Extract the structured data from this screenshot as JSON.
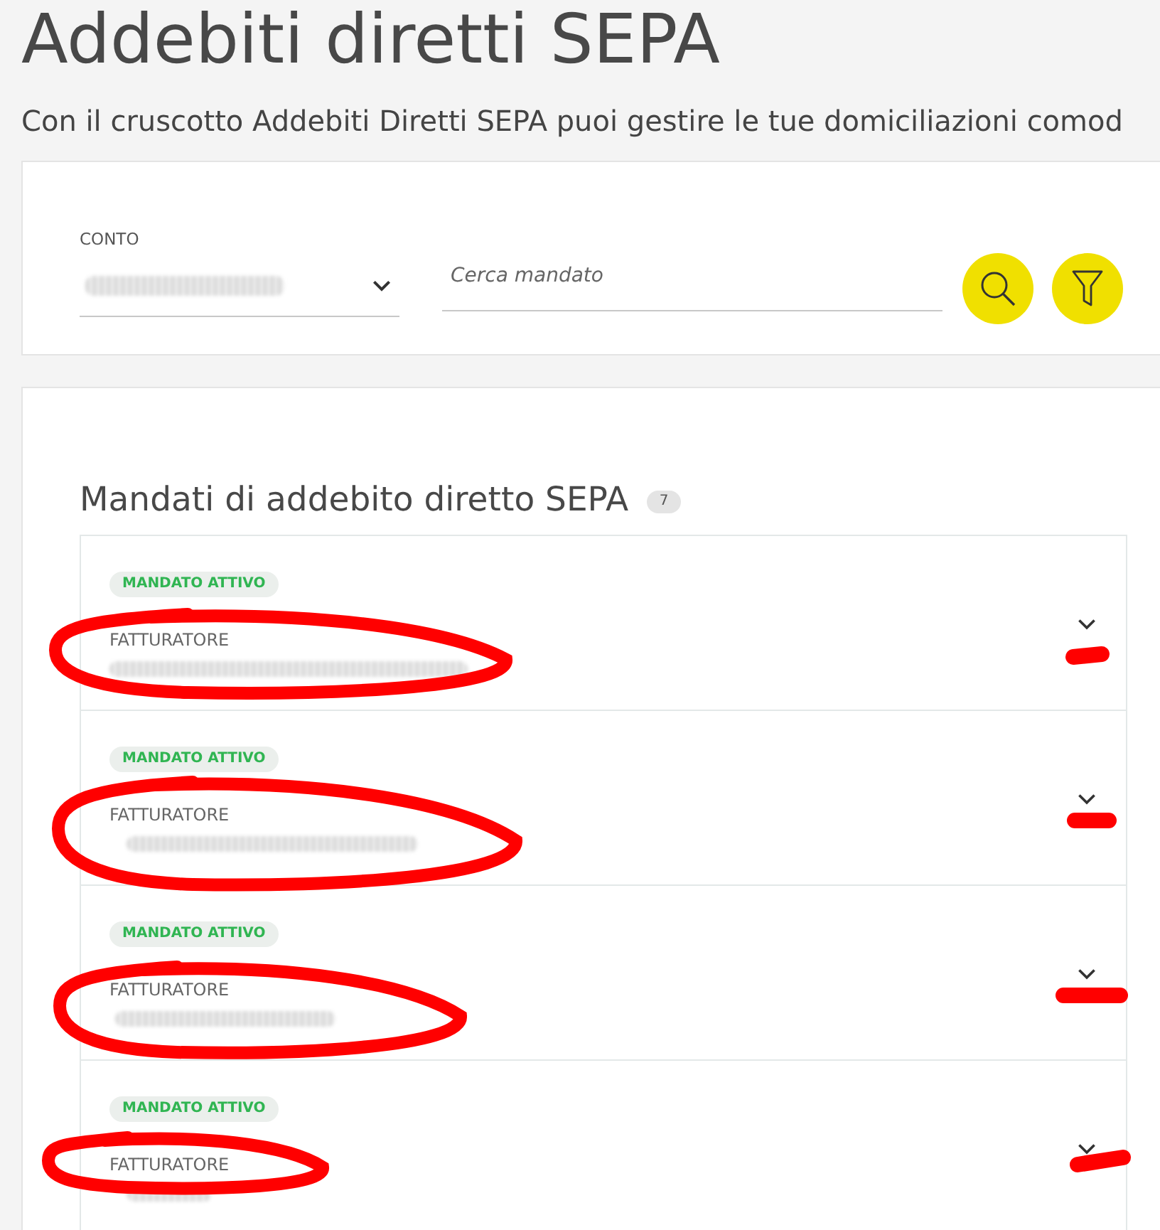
{
  "page": {
    "title": "Addebiti diretti SEPA",
    "subtitle": "Con il cruscotto Addebiti Diretti SEPA puoi gestire le tue domiciliazioni comod"
  },
  "filters": {
    "account": {
      "label": "CONTO"
    },
    "search": {
      "placeholder": "Cerca mandato"
    }
  },
  "mandates": {
    "title": "Mandati di addebito diretto SEPA",
    "count": "7",
    "items": [
      {
        "status": "MANDATO ATTIVO",
        "label": "FATTURATORE",
        "expanded": false
      },
      {
        "status": "MANDATO ATTIVO",
        "label": "FATTURATORE",
        "expanded": false
      },
      {
        "status": "MANDATO ATTIVO",
        "label": "FATTURATORE",
        "expanded": false
      },
      {
        "status": "MANDATO ATTIVO",
        "label": "FATTURATORE",
        "expanded": false
      }
    ]
  }
}
